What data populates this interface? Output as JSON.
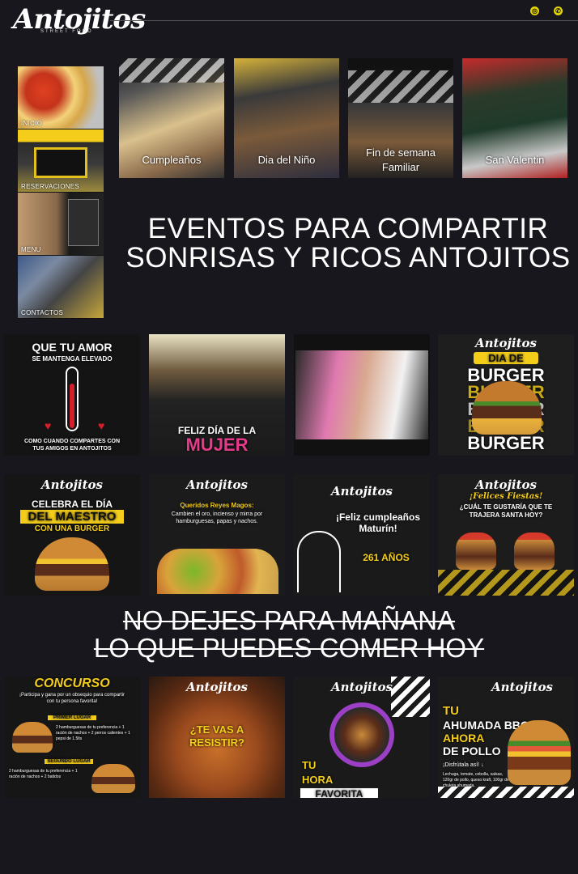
{
  "header": {
    "logo": "Antojitos",
    "logo_sub": "STREET FOOD",
    "instagram_icon": "instagram-icon",
    "whatsapp_icon": "whatsapp-icon"
  },
  "nav": [
    {
      "label": "INICIO"
    },
    {
      "label": "RESERVACIONES"
    },
    {
      "label": "MENU"
    },
    {
      "label": "CONTACTOS"
    }
  ],
  "events": [
    {
      "label": "Cumpleaños"
    },
    {
      "label": "Dia del Niño"
    },
    {
      "label": "Fin de semana Familiar"
    },
    {
      "label": "San Valentin"
    }
  ],
  "headline": "EVENTOS PARA COMPARTIR SONRISAS Y RICOS ANTOJITOS",
  "row1": {
    "t1": {
      "title": "QUE TU AMOR",
      "sub": "SE MANTENGA ELEVADO",
      "foot": "COMO CUANDO COMPARTES CON TUS AMIGOS EN ANTOJITOS"
    },
    "t2": {
      "line1": "FELIZ DÍA DE LA",
      "line2": "MUJER"
    },
    "t4": {
      "brand": "Antojitos",
      "badge": "DIA DE",
      "word": "BURGER"
    }
  },
  "row2": {
    "t1": {
      "brand": "Antojitos",
      "l1": "CELEBRA EL DÍA",
      "l2": "DEL MAESTRO",
      "l3": "CON UNA BURGER"
    },
    "t2": {
      "brand": "Antojitos",
      "title": "Queridos Reyes Magos:",
      "body": "Cambien el oro, incienso y mirra por hamburguesas, papas y nachos."
    },
    "t3": {
      "brand": "Antojitos",
      "title": "¡Feliz cumpleaños Maturín!",
      "years": "261 AÑOS"
    },
    "t4": {
      "brand": "Antojitos",
      "script": "¡Felices Fiestas!",
      "q": "¿CUÁL TE GUSTARÍA QUE TE TRAJERA SANTA HOY?"
    }
  },
  "slogan": {
    "line1": "NO DEJES PARA MAÑANA",
    "line2": "LO QUE PUEDES COMER HOY"
  },
  "row3": {
    "t1": {
      "title": "CONCURSO",
      "intro": "¡Participa y gana por un obsequio para compartir con tu persona favorita!",
      "p1": "PRIMER LUGAR",
      "p1d": "2 hamburguesas de tu preferencia + 1 ración de nachos + 2 perros calientes + 1 pepsi de 1.5lts",
      "p2": "SEGUNDO LUGAR",
      "p2d": "2 hamburguesas de tu preferencia + 1 ración de nachos + 2 batidos"
    },
    "t2": {
      "brand": "Antojitos",
      "l1": "¿TE VAS A",
      "l2": "RESISTIR?"
    },
    "t3": {
      "brand": "Antojitos",
      "l1": "TU",
      "l2": "HORA",
      "l3": "FAVORITA"
    },
    "t4": {
      "brand": "Antojitos",
      "l1": "TU",
      "l2": "AHUMADA BBQ",
      "l3": "AHORA",
      "l4": "DE POLLO",
      "sub": "¡Disfrútala así! ↓",
      "desc": "Lechuga, tomate, cebolla, salsas, 120gr de pollo, queso kraft, 100gr de chuleta ahumada."
    }
  }
}
